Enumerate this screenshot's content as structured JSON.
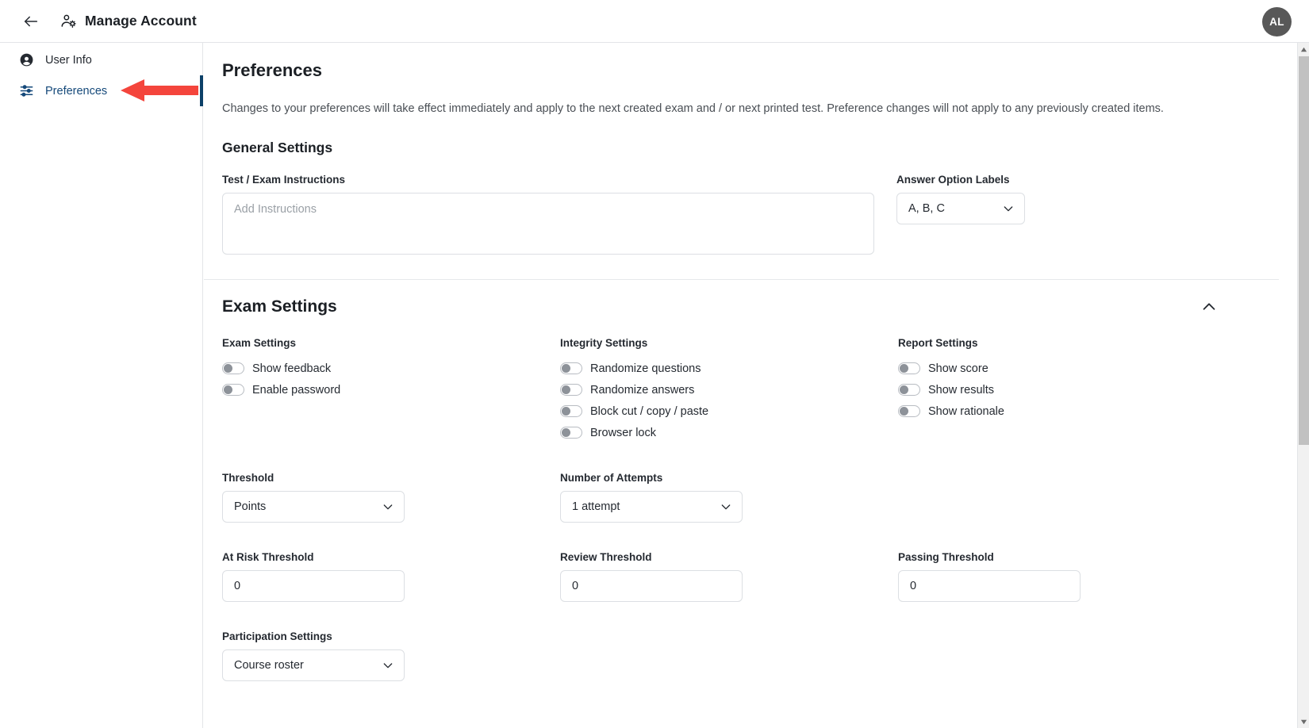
{
  "header": {
    "back_icon": "arrow-left-icon",
    "account_icon": "manage-account-icon",
    "title": "Manage Account",
    "avatar_initials": "AL"
  },
  "sidebar": {
    "items": [
      {
        "label": "User Info",
        "icon": "user-circle-icon",
        "active": false
      },
      {
        "label": "Preferences",
        "icon": "sliders-icon",
        "active": true
      }
    ]
  },
  "main": {
    "page_title": "Preferences",
    "intro": "Changes to your preferences will take effect immediately and apply to the next created exam and / or next printed test. Preference changes will not apply to any previously created items.",
    "general_settings": {
      "heading": "General Settings",
      "instructions_label": "Test / Exam Instructions",
      "instructions_value": "",
      "instructions_placeholder": "Add Instructions",
      "answer_labels_label": "Answer Option Labels",
      "answer_labels_value": "A, B, C"
    },
    "exam_settings": {
      "heading": "Exam Settings",
      "collapse_icon": "chevron-up-icon",
      "groups": [
        {
          "title": "Exam Settings",
          "toggles": [
            {
              "label": "Show feedback",
              "on": false
            },
            {
              "label": "Enable password",
              "on": false
            }
          ]
        },
        {
          "title": "Integrity Settings",
          "toggles": [
            {
              "label": "Randomize questions",
              "on": false
            },
            {
              "label": "Randomize answers",
              "on": false
            },
            {
              "label": "Block cut / copy / paste",
              "on": false
            },
            {
              "label": "Browser lock",
              "on": false
            }
          ]
        },
        {
          "title": "Report Settings",
          "toggles": [
            {
              "label": "Show score",
              "on": false
            },
            {
              "label": "Show results",
              "on": false
            },
            {
              "label": "Show rationale",
              "on": false
            }
          ]
        }
      ],
      "threshold_label": "Threshold",
      "threshold_value": "Points",
      "attempts_label": "Number of Attempts",
      "attempts_value": "1 attempt",
      "at_risk_label": "At Risk Threshold",
      "at_risk_value": "0",
      "review_label": "Review Threshold",
      "review_value": "0",
      "passing_label": "Passing Threshold",
      "passing_value": "0",
      "participation_label": "Participation Settings",
      "participation_value": "Course roster"
    }
  },
  "colors": {
    "accent": "#0c4068",
    "link": "#15497a",
    "annotation_arrow": "#f4453c",
    "avatar_bg": "#585858"
  }
}
